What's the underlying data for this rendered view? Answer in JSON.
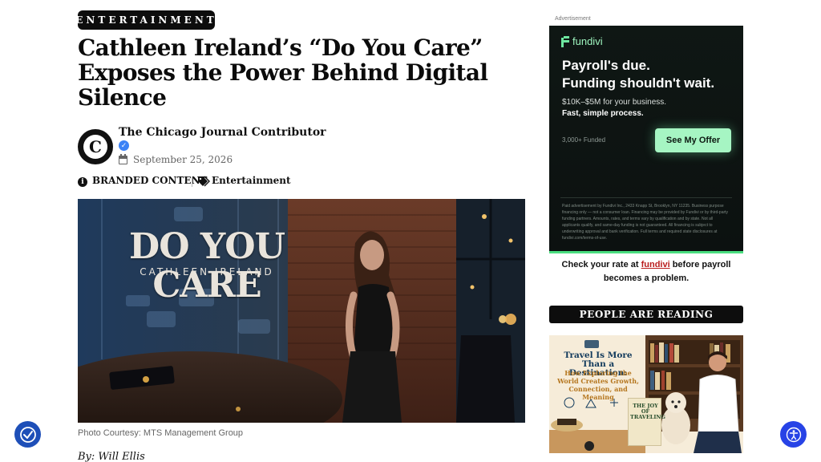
{
  "article": {
    "category": "ENTERTAINMENT",
    "headline": "Cathleen Ireland’s “Do You Care” Exposes the Power Behind Digital Silence",
    "author_initial": "C",
    "author": "The Chicago Journal Contributor",
    "date": "September 25, 2026",
    "branded_label": "BRANDED CONTENT",
    "tag": "Entertainment",
    "hero_title": "DO YOU CARE",
    "hero_subtitle": "CATHLEEN IRELAND",
    "caption": "Photo Courtesy: MTS Management Group",
    "byline": "By: Will Ellis"
  },
  "sidebar": {
    "ad_label": "Advertisement",
    "ad": {
      "brand": "fundivi",
      "headline_line1": "Payroll's due.",
      "headline_line2": "Funding shouldn't wait.",
      "range": "$10K–$5M for your business.",
      "process": "Fast, simple process.",
      "funded": "3,000+ Funded",
      "cta": "See My Offer",
      "fine_print": "Paid advertisement by Fundivi Inc., 2433 Knapp St, Brooklyn, NY 11235. Business purpose financing only — not a consumer loan. Financing may be provided by Fundivi or by third-party funding partners. Amounts, rates, and terms vary by qualification and by state. Not all applicants qualify, and same-day funding is not guaranteed. All financing is subject to underwriting approval and bank verification. Full terms and required state disclosures at fundivi.com/terms-of-use."
    },
    "ad_note_prefix": "Check your rate at ",
    "ad_note_link": "fundivi",
    "ad_note_suffix": " before payroll becomes a problem.",
    "section_title": "PEOPLE ARE READING",
    "promo": {
      "title": "Travel Is More Than a Destination:",
      "subtitle": "How Exploring the World Creates Growth, Connection, and Meaning",
      "book_title": "THE JOY OF TRAVELING"
    }
  },
  "colors": {
    "ad_accent": "#4ade80",
    "link_red": "#b91c1c",
    "accessibility_blue": "#2743e6"
  },
  "icons": [
    "verified-badge-icon",
    "calendar-icon",
    "info-icon",
    "tag-icon",
    "accessibility-icon",
    "accessibility-person-icon"
  ]
}
